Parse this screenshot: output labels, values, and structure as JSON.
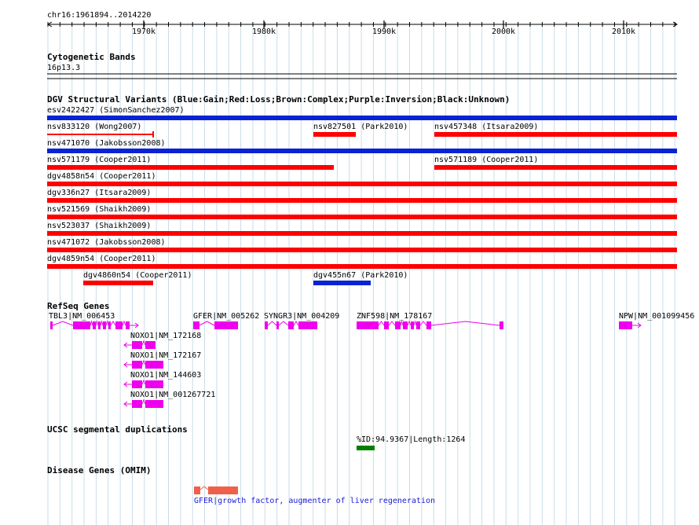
{
  "ruler": {
    "region": "chr16:1961894..2014220",
    "ticks": [
      "1970k",
      "1980k",
      "1990k",
      "2000k",
      "2010k"
    ]
  },
  "cytoband": {
    "title": "Cytogenetic Bands",
    "band": "16p13.3"
  },
  "dgv": {
    "title": "DGV Structural Variants (Blue:Gain;Red:Loss;Brown:Complex;Purple:Inversion;Black:Unknown)",
    "colors": {
      "gain": "#0a23d2",
      "loss": "#ff0000"
    },
    "rows": [
      [
        {
          "label": "esv2422427 (SimonSanchez2007)",
          "type": "gain"
        }
      ],
      [
        {
          "label": "nsv833120 (Wong2007)",
          "type": "loss",
          "thin": true
        },
        {
          "label": "nsv827501 (Park2010)",
          "type": "loss"
        },
        {
          "label": "nsv457348 (Itsara2009)",
          "type": "loss"
        }
      ],
      [
        {
          "label": "nsv471070 (Jakobsson2008)",
          "type": "gain"
        }
      ],
      [
        {
          "label": "nsv571179 (Cooper2011)",
          "type": "loss"
        },
        {
          "label": "nsv571189 (Cooper2011)",
          "type": "loss"
        }
      ],
      [
        {
          "label": "dgv4858n54 (Cooper2011)",
          "type": "loss"
        }
      ],
      [
        {
          "label": "dgv336n27 (Itsara2009)",
          "type": "loss"
        }
      ],
      [
        {
          "label": "nsv521569 (Shaikh2009)",
          "type": "loss"
        }
      ],
      [
        {
          "label": "nsv523037 (Shaikh2009)",
          "type": "loss"
        }
      ],
      [
        {
          "label": "nsv471072 (Jakobsson2008)",
          "type": "loss"
        }
      ],
      [
        {
          "label": "dgv4859n54 (Cooper2011)",
          "type": "loss"
        }
      ],
      [
        {
          "label": "dgv4860n54 (Cooper2011)",
          "type": "loss"
        },
        {
          "label": "dgv455n67 (Park2010)",
          "type": "gain"
        }
      ]
    ]
  },
  "refseq": {
    "title": "RefSeq Genes",
    "color": "#ee00ee",
    "genes": [
      {
        "label": "TBL3|NM_006453",
        "strand": "+"
      },
      {
        "label": "GFER|NM_005262",
        "strand": "+"
      },
      {
        "label": "SYNGR3|NM_004209",
        "strand": "+"
      },
      {
        "label": "ZNF598|NM_178167",
        "strand": "-"
      },
      {
        "label": "NPW|NM_001099456",
        "strand": "+"
      },
      {
        "label": "NOXO1|NM_172168",
        "strand": "-"
      },
      {
        "label": "NOXO1|NM_172167",
        "strand": "-"
      },
      {
        "label": "NOXO1|NM_144603",
        "strand": "-"
      },
      {
        "label": "NOXO1|NM_001267721",
        "strand": "-"
      }
    ]
  },
  "segdup": {
    "title": "UCSC segmental duplications",
    "label": "%ID:94.9367|Length:1264",
    "color": "#008000"
  },
  "omim": {
    "title": "Disease Genes (OMIM)",
    "label": "GFER|growth factor, augmenter of liver regeneration",
    "color": "#f06048"
  }
}
